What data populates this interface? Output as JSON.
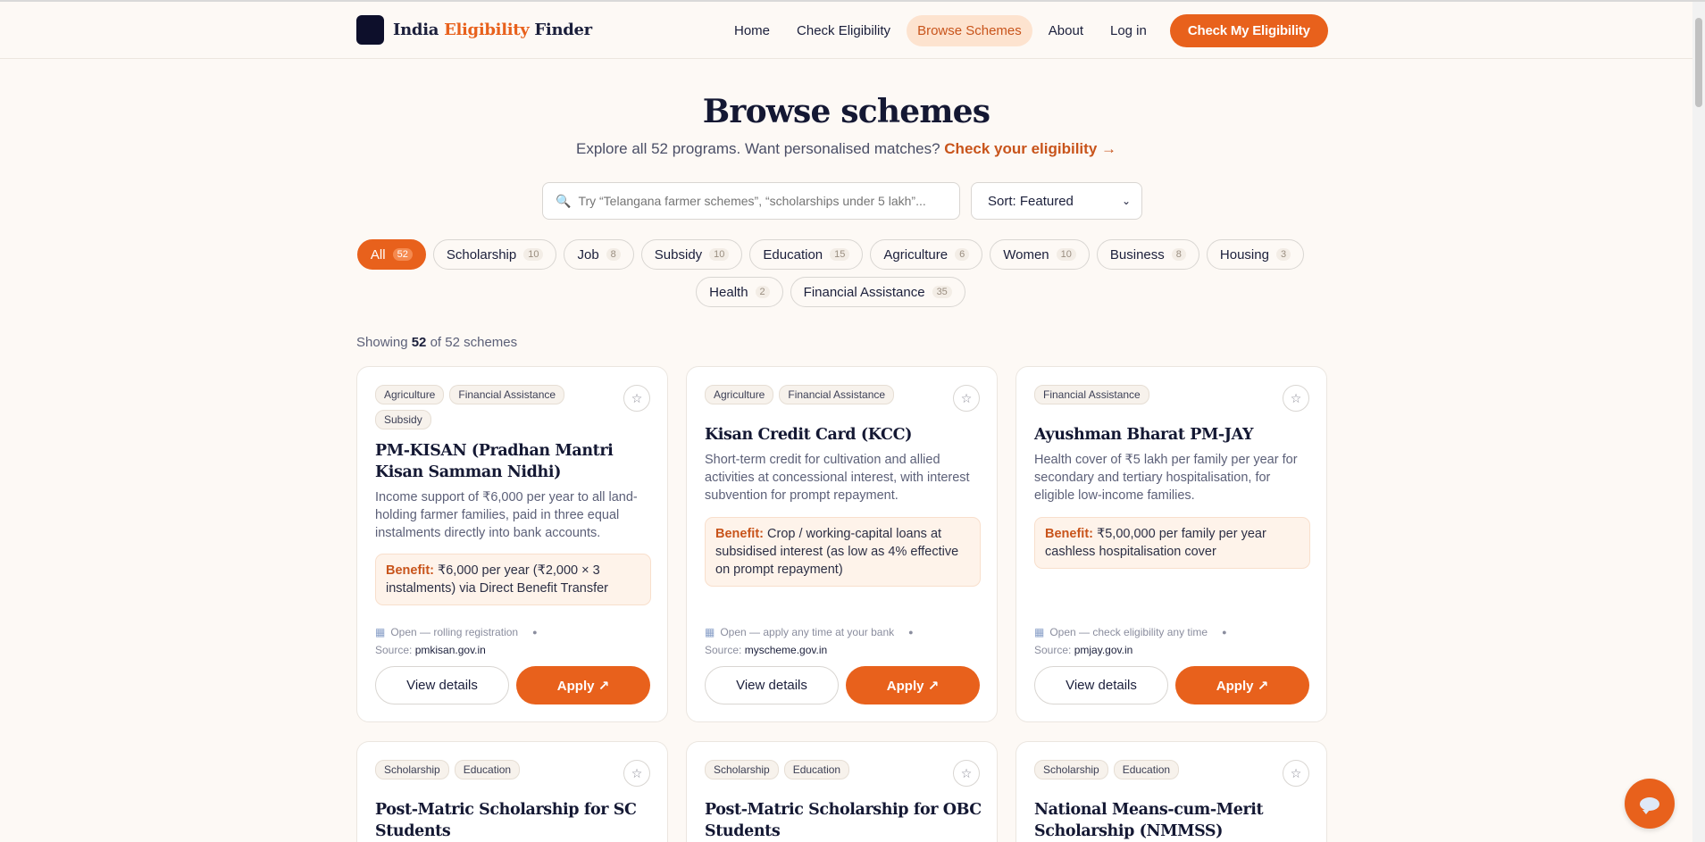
{
  "brand": {
    "name_part1": "India ",
    "name_part2": "Eligibility",
    "name_part3": " Finder"
  },
  "nav": {
    "items": [
      {
        "label": "Home"
      },
      {
        "label": "Check Eligibility"
      },
      {
        "label": "Browse Schemes"
      },
      {
        "label": "About"
      },
      {
        "label": "Log in"
      }
    ],
    "active": "Browse Schemes",
    "cta_label": "Check My Eligibility"
  },
  "hero": {
    "title": "Browse schemes",
    "subtitle": "Explore all 52 programs. Want personalised matches? ",
    "subtitle_link": "Check your eligibility →"
  },
  "search": {
    "placeholder": "Try “Telangana farmer schemes”, “scholarships under 5 lakh”..."
  },
  "sort": {
    "selected": "Sort: Featured"
  },
  "filters": [
    {
      "label": "All",
      "count": "52"
    },
    {
      "label": "Scholarship",
      "count": "10"
    },
    {
      "label": "Job",
      "count": "8"
    },
    {
      "label": "Subsidy",
      "count": "10"
    },
    {
      "label": "Education",
      "count": "15"
    },
    {
      "label": "Agriculture",
      "count": "6"
    },
    {
      "label": "Women",
      "count": "10"
    },
    {
      "label": "Business",
      "count": "8"
    },
    {
      "label": "Housing",
      "count": "3"
    },
    {
      "label": "Health",
      "count": "2"
    },
    {
      "label": "Financial Assistance",
      "count": "35"
    }
  ],
  "results": {
    "prefix": "Showing ",
    "shown": "52",
    "suffix": " of 52 schemes"
  },
  "cards": [
    {
      "tags": [
        "Agriculture",
        "Financial Assistance",
        "Subsidy"
      ],
      "title": "PM-KISAN (Pradhan Mantri Kisan Samman Nidhi)",
      "description": "Income support of ₹6,000 per year to all land-holding farmer families, paid in three equal instalments directly into bank accounts.",
      "benefit_label": "Benefit:",
      "benefit": " ₹6,000 per year (₹2,000 × 3 instalments) via Direct Benefit Transfer",
      "status": "Open — rolling registration",
      "source_label": "Source: ",
      "source": "pmkisan.gov.in",
      "view_label": "View details",
      "apply_label": "Apply ↗"
    },
    {
      "tags": [
        "Agriculture",
        "Financial Assistance"
      ],
      "title": "Kisan Credit Card (KCC)",
      "description": "Short-term credit for cultivation and allied activities at concessional interest, with interest subvention for prompt repayment.",
      "benefit_label": "Benefit:",
      "benefit": " Crop / working-capital loans at subsidised interest (as low as 4% effective on prompt repayment)",
      "status": "Open — apply any time at your bank",
      "source_label": "Source: ",
      "source": "myscheme.gov.in",
      "view_label": "View details",
      "apply_label": "Apply ↗"
    },
    {
      "tags": [
        "Financial Assistance"
      ],
      "title": "Ayushman Bharat PM-JAY",
      "description": "Health cover of ₹5 lakh per family per year for secondary and tertiary hospitalisation, for eligible low-income families.",
      "benefit_label": "Benefit:",
      "benefit": " ₹5,00,000 per family per year cashless hospitalisation cover",
      "status": "Open — check eligibility any time",
      "source_label": "Source: ",
      "source": "pmjay.gov.in",
      "view_label": "View details",
      "apply_label": "Apply ↗"
    },
    {
      "tags": [
        "Scholarship",
        "Education"
      ],
      "title": "Post-Matric Scholarship for SC Students"
    },
    {
      "tags": [
        "Scholarship",
        "Education"
      ],
      "title": "Post-Matric Scholarship for OBC Students"
    },
    {
      "tags": [
        "Scholarship",
        "Education"
      ],
      "title": "National Means-cum-Merit Scholarship (NMMSS)"
    }
  ],
  "colors": {
    "accent": "#e8611c",
    "background": "#fdf9f5",
    "ink": "#1b1f3b"
  }
}
